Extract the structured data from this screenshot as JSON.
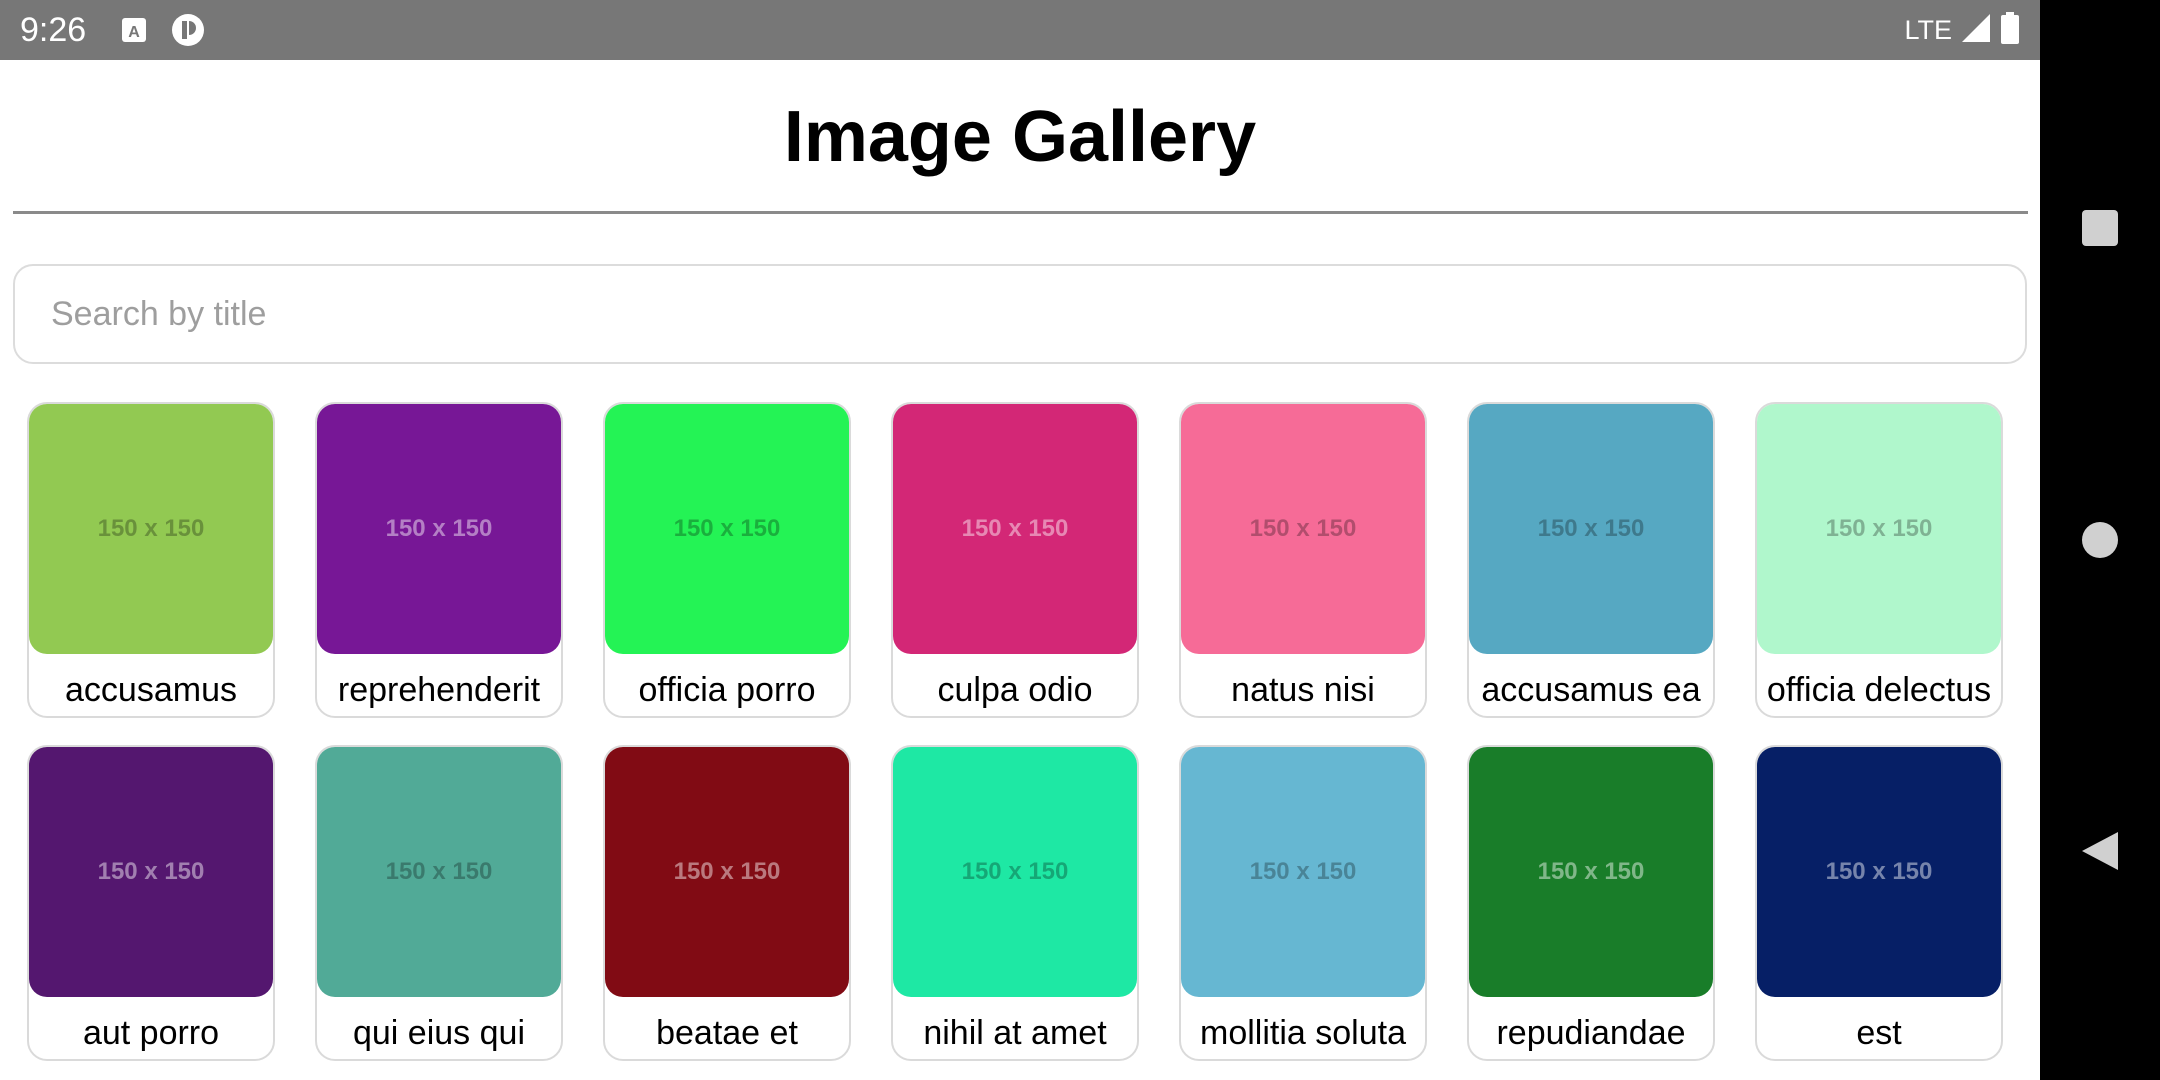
{
  "status_bar": {
    "time": "9:26",
    "network": "LTE",
    "left_icons": [
      "keyboard-a-icon",
      "notification-p-icon"
    ],
    "right_icons": [
      "signal-icon",
      "battery-icon"
    ]
  },
  "header": {
    "title": "Image Gallery"
  },
  "search": {
    "placeholder": "Search by title",
    "value": ""
  },
  "gallery": {
    "items": [
      {
        "title": "accusamus",
        "color": "#92c952",
        "image_text": "150 x 150"
      },
      {
        "title": "reprehenderit",
        "color": "#771796",
        "image_text": "150 x 150"
      },
      {
        "title": "officia porro",
        "color": "#24f355",
        "image_text": "150 x 150"
      },
      {
        "title": "culpa odio",
        "color": "#d32776",
        "image_text": "150 x 150"
      },
      {
        "title": "natus nisi",
        "color": "#f66b97",
        "image_text": "150 x 150"
      },
      {
        "title": "accusamus ea",
        "color": "#56a8c2",
        "image_text": "150 x 150"
      },
      {
        "title": "officia delectus",
        "color": "#b0f7cc",
        "image_text": "150 x 150"
      },
      {
        "title": "aut porro",
        "color": "#54176f",
        "image_text": "150 x 150"
      },
      {
        "title": "qui eius qui",
        "color": "#51aa97",
        "image_text": "150 x 150"
      },
      {
        "title": "beatae et",
        "color": "#810b14",
        "image_text": "150 x 150"
      },
      {
        "title": "nihil at amet",
        "color": "#1ee8a4",
        "image_text": "150 x 150"
      },
      {
        "title": "mollitia soluta",
        "color": "#66b7d2",
        "image_text": "150 x 150"
      },
      {
        "title": "repudiandae",
        "color": "#197d29",
        "image_text": "150 x 150"
      },
      {
        "title": "est",
        "color": "#061f66",
        "image_text": "150 x 150"
      }
    ]
  },
  "nav_bar": {
    "buttons": [
      "recents-square-icon",
      "home-circle-icon",
      "back-triangle-icon"
    ]
  }
}
